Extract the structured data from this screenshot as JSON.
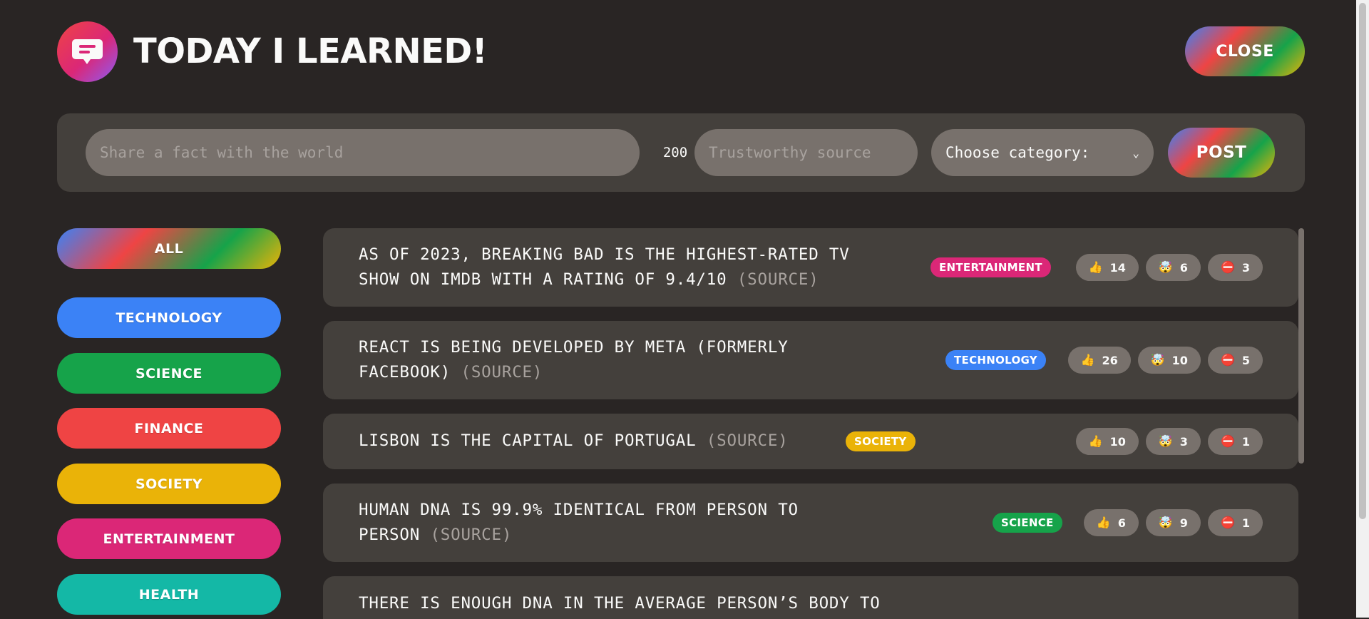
{
  "app": {
    "title": "Today I Learned!",
    "close_label": "Close"
  },
  "form": {
    "fact_placeholder": "Share a fact with the world",
    "char_count": "200",
    "source_placeholder": "Trustworthy source",
    "category_selected": "Choose category:",
    "post_label": "Post"
  },
  "categories": [
    {
      "label": "All",
      "color": "gradient"
    },
    {
      "label": "technology",
      "color": "#3b82f6"
    },
    {
      "label": "science",
      "color": "#16a34a"
    },
    {
      "label": "finance",
      "color": "#ef4444"
    },
    {
      "label": "society",
      "color": "#eab308"
    },
    {
      "label": "entertainment",
      "color": "#db2777"
    },
    {
      "label": "health",
      "color": "#14b8a6"
    }
  ],
  "facts": [
    {
      "text_line1": "As of 2023, Breaking Bad is the highest-rated TV",
      "text_line2": "show on IMDb with a rating of 9.4/10",
      "source": "(Source)",
      "category": "entertainment",
      "category_color": "#db2777",
      "votes_interesting": "14",
      "votes_mindblowing": "6",
      "votes_false": "3"
    },
    {
      "text_line1": "React is being developed by Meta (formerly",
      "text_line2": "facebook)",
      "source": "(Source)",
      "category": "technology",
      "category_color": "#3b82f6",
      "votes_interesting": "26",
      "votes_mindblowing": "10",
      "votes_false": "5"
    },
    {
      "text_line1": "Lisbon is the capital of Portugal",
      "source": "(Source)",
      "category": "society",
      "category_color": "#eab308",
      "votes_interesting": "10",
      "votes_mindblowing": "3",
      "votes_false": "1"
    },
    {
      "text_line1": "Human DNA is 99.9% identical from person to",
      "text_line2": "person",
      "source": "(Source)",
      "category": "science",
      "category_color": "#16a34a",
      "votes_interesting": "6",
      "votes_mindblowing": "9",
      "votes_false": "1"
    },
    {
      "text_line1": "There is enough DNA in the average person’s body to"
    }
  ],
  "icons": {
    "thumbs_up": "👍",
    "mind_blown": "🤯",
    "no_entry": "⛔"
  }
}
